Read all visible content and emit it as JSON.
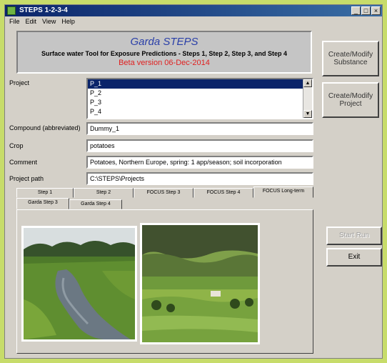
{
  "window": {
    "title": "STEPS 1-2-3-4"
  },
  "menu": [
    "File",
    "Edit",
    "View",
    "Help"
  ],
  "header": {
    "brand": "Garda STEPS",
    "subtitle": "Surface water Tool for Exposure Predictions - Steps 1, Step 2, Step 3, and Step 4",
    "version": "Beta version   06-Dec-2014"
  },
  "buttons": {
    "create_substance": "Create/Modify Substance",
    "create_project": "Create/Modify Project",
    "run_disabled": "Start Run",
    "exit": "Exit"
  },
  "form": {
    "project_label": "Project",
    "projects": [
      "P_1",
      "P_2",
      "P_3",
      "P_4"
    ],
    "compound_label": "Compound (abbreviated)",
    "compound_value": "Dummy_1",
    "crop_label": "Crop",
    "crop_value": "potatoes",
    "comment_label": "Comment",
    "comment_value": "Potatoes, Northern Europe, spring: 1 app/season; soil incorporation",
    "projectpath_label": "Project path",
    "projectpath_value": "C:\\STEPS\\Projects"
  },
  "tabs_row1": [
    "Step 1",
    "Step 2",
    "FOCUS Step 3",
    "FOCUS Step 4",
    "FOCUS Long-term"
  ],
  "tabs_row2": [
    "Garda Step 3",
    "Garda Step 4"
  ]
}
